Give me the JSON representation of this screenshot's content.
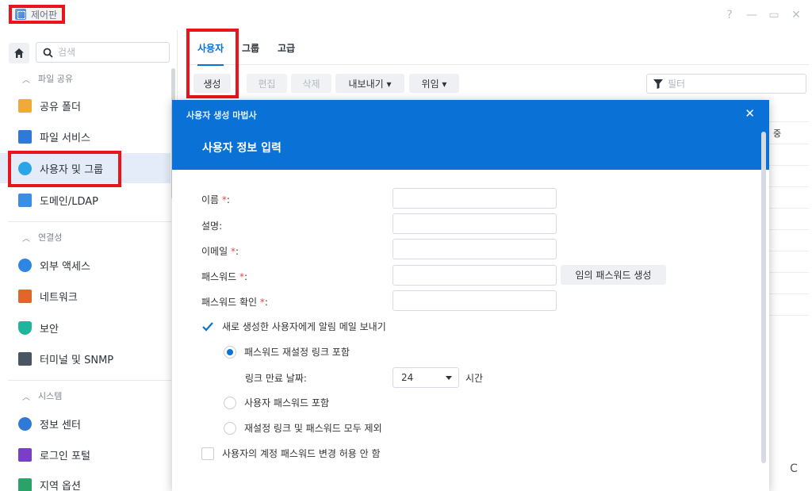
{
  "window": {
    "title": "제어판",
    "controls": [
      "?",
      "—",
      "▭",
      "✕"
    ]
  },
  "sidebar": {
    "search_placeholder": "검색",
    "sections": [
      {
        "label": "파일 공유",
        "items": [
          {
            "label": "공유 폴더",
            "icon": "shared-folder-icon",
            "color": "#f2a93b"
          },
          {
            "label": "파일 서비스",
            "icon": "file-services-icon",
            "color": "#2f7ad9"
          },
          {
            "label": "사용자 및 그룹",
            "icon": "users-groups-icon",
            "color": "#2aa6e8",
            "active": true
          },
          {
            "label": "도메인/LDAP",
            "icon": "domain-ldap-icon",
            "color": "#3a8ee6"
          }
        ]
      },
      {
        "label": "연결성",
        "items": [
          {
            "label": "외부 액세스",
            "icon": "external-access-icon",
            "color": "#2f86e2"
          },
          {
            "label": "네트워크",
            "icon": "network-icon",
            "color": "#e0672a"
          },
          {
            "label": "보안",
            "icon": "security-shield-icon",
            "color": "#1fb59c"
          },
          {
            "label": "터미널 및 SNMP",
            "icon": "terminal-icon",
            "color": "#4a5563"
          }
        ]
      },
      {
        "label": "시스템",
        "items": [
          {
            "label": "정보 센터",
            "icon": "info-center-icon",
            "color": "#2f7ad9"
          },
          {
            "label": "로그인 포털",
            "icon": "login-portal-icon",
            "color": "#7b3fc6"
          },
          {
            "label": "지역 옵션",
            "icon": "regional-options-icon",
            "color": "#2aa36b"
          }
        ]
      }
    ]
  },
  "tabs": [
    "사용자",
    "그룹",
    "고급"
  ],
  "toolbar": {
    "create": "생성",
    "edit": "편집",
    "delete": "삭제",
    "export": "내보내기 ▾",
    "delegate": "위임 ▾",
    "filter_placeholder": "필터"
  },
  "background": {
    "cell_text": "중",
    "refresh": "C"
  },
  "modal": {
    "wizard_title": "사용자 생성 마법사",
    "close": "✕",
    "step_title": "사용자 정보 입력",
    "fields": {
      "name": "이름",
      "description": "설명",
      "email": "이메일",
      "password": "패스워드",
      "confirm_password": "패스워드 확인"
    },
    "required_mark": "*",
    "colon": ":",
    "random_password_button": "임의 패스워드 생성",
    "send_notification": "새로 생성한 사용자에게 알림 메일 보내기",
    "include_reset_link": "패스워드 재설정 링크 포함",
    "link_expiry_label": "링크 만료 날짜:",
    "link_expiry_value": "24",
    "link_expiry_unit": "시간",
    "include_user_password": "사용자 패스워드 포함",
    "exclude_both": "재설정 링크 및 패스워드 모두 제외",
    "disallow_password_change": "사용자의 계정 패스워드 변경 허용 안 함"
  },
  "colors": {
    "accent": "#0a72d6",
    "highlight": "#e8151b",
    "required": "#e54848"
  }
}
